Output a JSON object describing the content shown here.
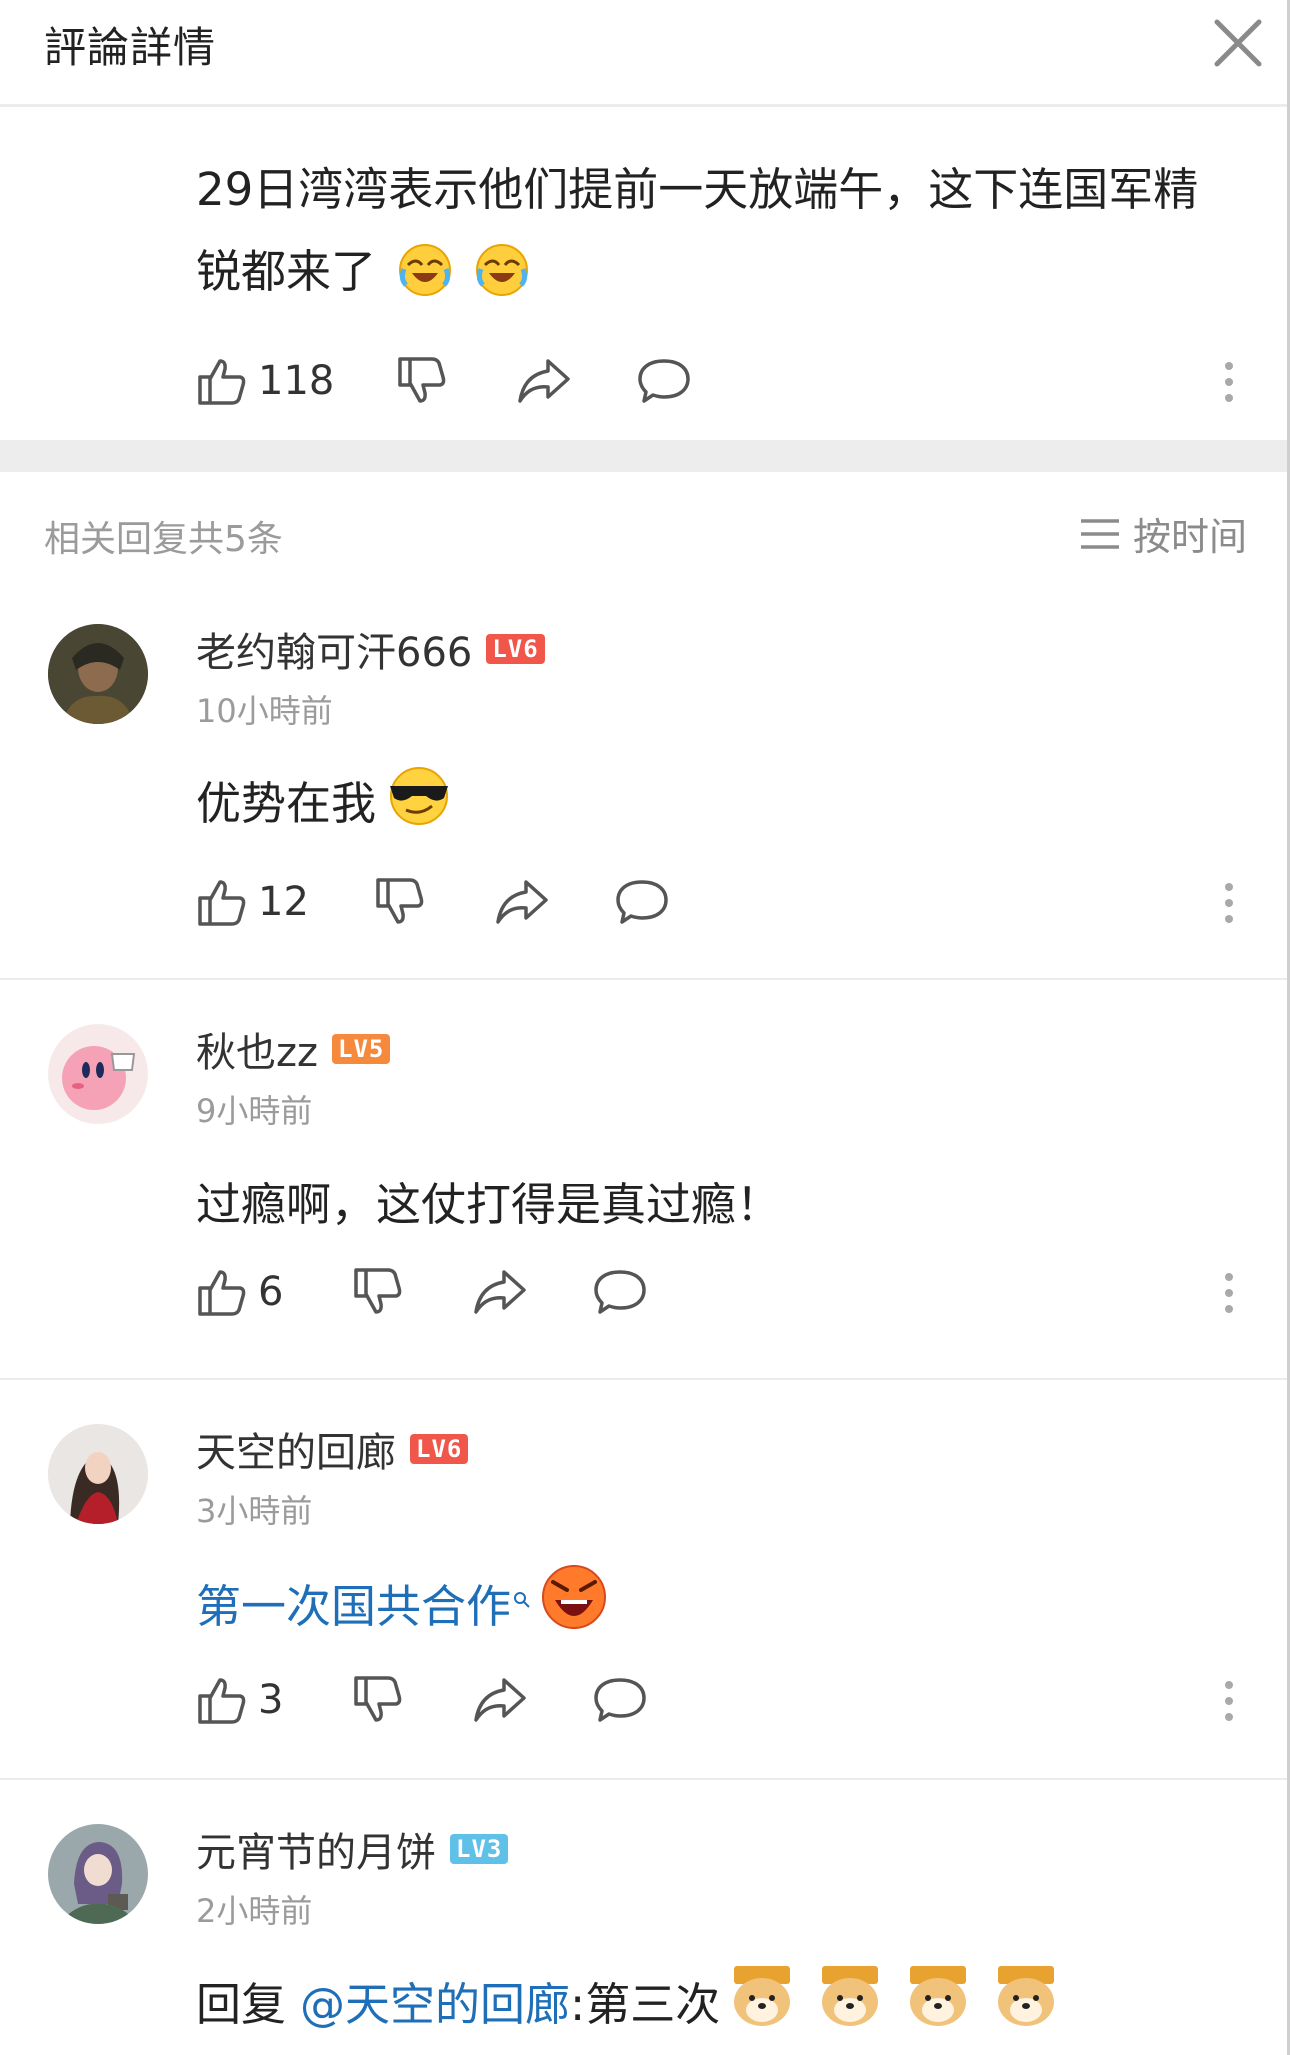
{
  "header": {
    "title": "評論詳情",
    "close_icon": "close-icon"
  },
  "main_comment": {
    "text": "29日湾湾表示他们提前一天放端午，这下连国军精锐都来了",
    "likes": "118"
  },
  "replies_header": {
    "count_label": "相关回复共5条",
    "sort_label": "按时间"
  },
  "replies": [
    {
      "username": "老约翰可汗666",
      "level": "LV6",
      "level_color": "#f0564a",
      "time": "10小時前",
      "text": "优势在我",
      "likes": "12"
    },
    {
      "username": "秋也zz",
      "level": "LV5",
      "level_color": "#f68a3c",
      "time": "9小時前",
      "text": "过瘾啊，这仗打得是真过瘾！",
      "likes": "6"
    },
    {
      "username": "天空的回廊",
      "level": "LV6",
      "level_color": "#f0564a",
      "time": "3小時前",
      "text": "第一次国共合作",
      "likes": "3"
    },
    {
      "username": "元宵节的月饼",
      "level": "LV3",
      "level_color": "#5fc0e8",
      "time": "2小時前",
      "reply_prefix": "回复",
      "reply_mention": "@天空的回廊",
      "reply_text": ":第三次"
    }
  ],
  "colors": {
    "accent_link": "#1e6fb8",
    "muted_text": "#9b9b9b",
    "divider": "#ececec"
  }
}
